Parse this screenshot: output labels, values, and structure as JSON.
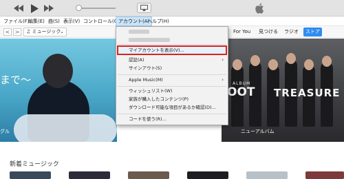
{
  "toolbar": {
    "rewind_icon": "rewind-icon",
    "play_icon": "play-icon",
    "forward_icon": "fast-forward-icon",
    "airplay_icon": "airplay-icon",
    "apple_icon": "apple-logo-icon"
  },
  "menubar": {
    "items": [
      {
        "label": "ファイル(F)"
      },
      {
        "label": "編集(E)"
      },
      {
        "label": "曲(S)"
      },
      {
        "label": "表示(V)"
      },
      {
        "label": "コントロール(C)"
      },
      {
        "label": "アカウント(A)"
      },
      {
        "label": "ヘルプ(H)"
      }
    ],
    "active_index": 5
  },
  "nav": {
    "back": "<",
    "forward": ">",
    "media_label": "♫ ミュージック",
    "tabs": [
      "For You",
      "見つける",
      "ラジオ",
      "ストア"
    ],
    "active_tab": "ストア"
  },
  "account_menu": {
    "items": [
      {
        "label": "マイアカウントを表示(V)...",
        "highlighted": true
      },
      {
        "label": "認証(A)",
        "submenu": true
      },
      {
        "label": "サインアウト(S)"
      },
      {
        "label": "Apple Music(M)",
        "submenu": true
      },
      {
        "label": "ウィッシュリスト(W)"
      },
      {
        "label": "家族が購入したコンテンツ(P)"
      },
      {
        "label": "ダウンロード可能な項目があるか確認(D)..."
      },
      {
        "label": "コードを使う(R)..."
      }
    ],
    "submenu_arrow": "›",
    "highlight_color": "#e02020"
  },
  "banners": {
    "left_text": "まで〜",
    "left_sub": "グル",
    "right_tag": "ALBUM",
    "right_big": "OOT",
    "right_name": "TREASURE",
    "right_sub": "ニューアルバム"
  },
  "section": {
    "title": "新着ミュージック"
  },
  "colors": {
    "accent": "#2f8cf0",
    "menu_active": "#cce4f7"
  }
}
